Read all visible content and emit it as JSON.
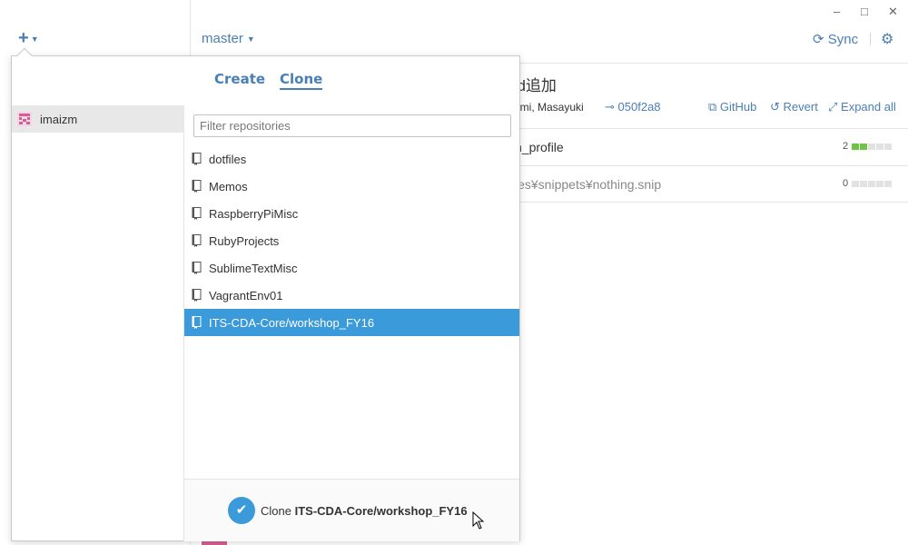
{
  "header": {
    "add_icon": "plus-icon",
    "branch_label": "master",
    "sync_label": "Sync",
    "settings_icon": "gear-icon",
    "window_controls": {
      "minimize": "–",
      "maximize": "□",
      "close": "✕"
    }
  },
  "commit": {
    "title_partial": "nd追加",
    "author_partial": "zumi, Masayuki",
    "sha": "050f2a8",
    "actions": {
      "github": "GitHub",
      "revert": "Revert",
      "expand_all": "Expand all"
    },
    "files": [
      {
        "name": "sh_profile",
        "count": "2",
        "added": 2
      },
      {
        "name": "files¥snippets¥nothing.snip",
        "count": "0",
        "added": 0
      }
    ]
  },
  "popover": {
    "tabs": {
      "create": "Create",
      "clone": "Clone",
      "active": "clone"
    },
    "account": {
      "name": "imaizm"
    },
    "filter": {
      "placeholder": "Filter repositories",
      "value": ""
    },
    "repositories": [
      {
        "name": "dotfiles",
        "selected": false
      },
      {
        "name": "Memos",
        "selected": false
      },
      {
        "name": "RaspberryPiMisc",
        "selected": false
      },
      {
        "name": "RubyProjects",
        "selected": false
      },
      {
        "name": "SublimeTextMisc",
        "selected": false
      },
      {
        "name": "VagrantEnv01",
        "selected": false
      },
      {
        "name": "ITS-CDA-Core/workshop_FY16",
        "selected": true
      }
    ],
    "clone_button": {
      "prefix": "Clone",
      "repo": "ITS-CDA-Core/workshop_FY16"
    }
  },
  "colors": {
    "accent": "#4a7fb5",
    "selection": "#3b9ad9",
    "additions": "#6cc644"
  }
}
